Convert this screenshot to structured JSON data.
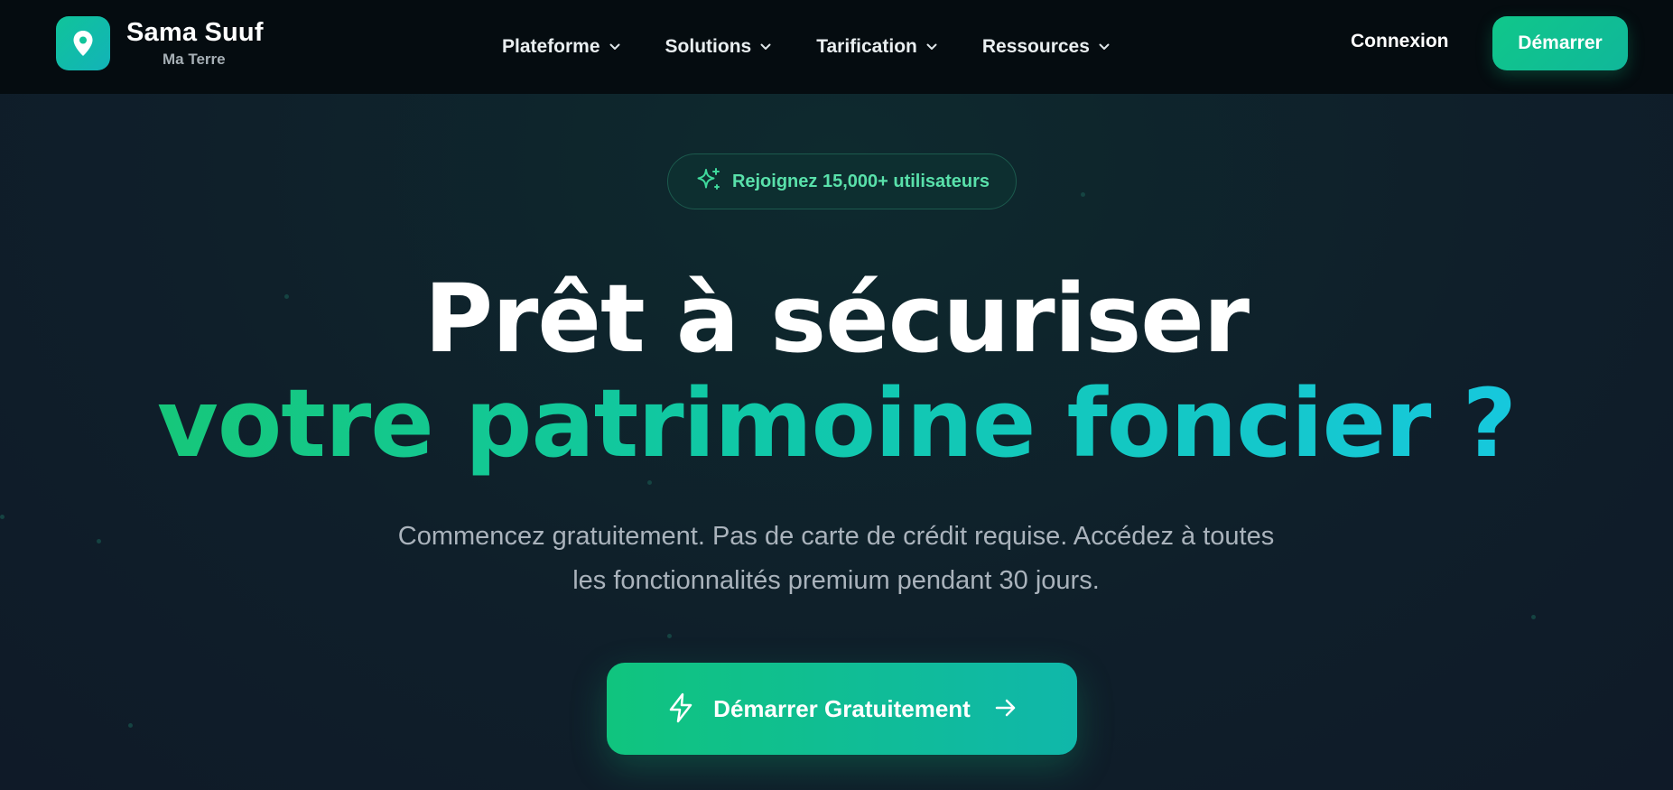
{
  "brand": {
    "name": "Sama Suuf",
    "tagline": "Ma Terre",
    "logo_icon": "map-pin-icon"
  },
  "nav": {
    "items": [
      {
        "label": "Plateforme",
        "icon": "chevron-down-icon"
      },
      {
        "label": "Solutions",
        "icon": "chevron-down-icon"
      },
      {
        "label": "Tarification",
        "icon": "chevron-down-icon"
      },
      {
        "label": "Ressources",
        "icon": "chevron-down-icon"
      }
    ],
    "login_label": "Connexion",
    "start_label": "Démarrer"
  },
  "hero": {
    "badge_icon": "sparkles-icon",
    "badge_text": "Rejoignez 15,000+ utilisateurs",
    "headline_line1": "Prêt à sécuriser",
    "headline_line2": "votre patrimoine foncier ?",
    "subtext": "Commencez gratuitement. Pas de carte de crédit requise. Accédez à toutes les fonctionnalités premium pendant 30 jours.",
    "cta_label": "Démarrer Gratuitement",
    "cta_icon_left": "lightning-icon",
    "cta_icon_right": "arrow-right-icon"
  },
  "colors": {
    "accent_green": "#10c78a",
    "accent_cyan": "#18c8e8",
    "topbar_bg": "#050c10",
    "hero_bg": "#0f1f2a"
  }
}
